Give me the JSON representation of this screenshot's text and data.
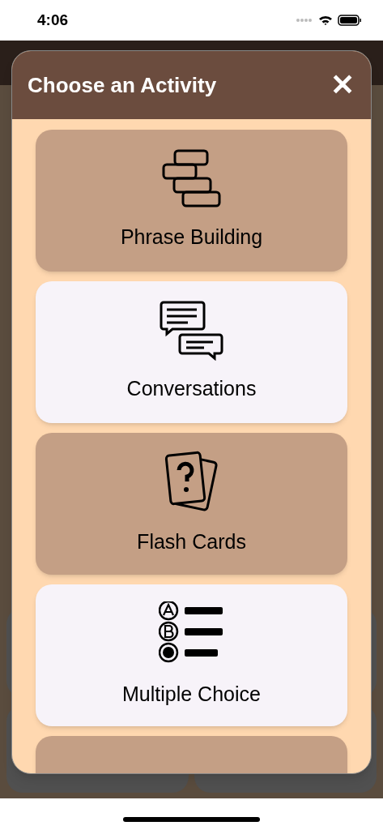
{
  "status_bar": {
    "time": "4:06"
  },
  "dialog": {
    "title": "Choose an Activity",
    "close": "✕"
  },
  "activities": [
    {
      "kind": "bricks",
      "label": "Phrase Building",
      "color": "#c49f85"
    },
    {
      "kind": "chat",
      "label": "Conversations",
      "color": "#f7f3f9"
    },
    {
      "kind": "cards",
      "label": "Flash Cards",
      "color": "#c49f85"
    },
    {
      "kind": "choice",
      "label": "Multiple Choice",
      "color": "#f7f3f9"
    },
    {
      "kind": "partial",
      "color": "#c49f85"
    }
  ]
}
